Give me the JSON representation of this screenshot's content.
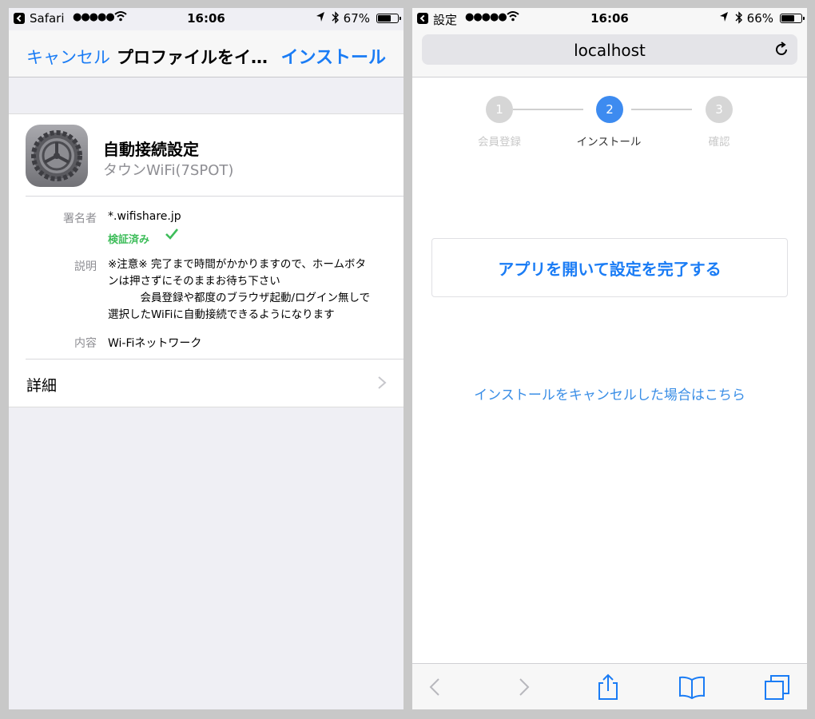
{
  "left": {
    "status": {
      "app": "Safari",
      "signal": "●●●●●",
      "time": "16:06",
      "battery_pct": "67%",
      "battery_level": 0.67
    },
    "nav": {
      "cancel": "キャンセル",
      "title": "プロファイルをイ…",
      "install": "インストール"
    },
    "profile": {
      "icon": "settings-gear-icon",
      "name": "自動接続設定",
      "org": "タウンWiFi(7SPOT)",
      "signer_label": "署名者",
      "signer": "*.wifishare.jp",
      "verified": "検証済み",
      "description_label": "説明",
      "description_lines": [
        "※注意※ 完了まで時間がかかりますので、ホームボタ",
        "ンは押さずにそのままお待ち下さい",
        "　　　会員登録や都度のブラウザ起動/ログイン無しで",
        "選択したWiFiに自動接続できるようになります"
      ],
      "contents_label": "内容",
      "contents": "Wi-Fiネットワーク",
      "details": "詳細"
    }
  },
  "right": {
    "status": {
      "app": "設定",
      "signal": "●●●●●",
      "time": "16:06",
      "battery_pct": "66%",
      "battery_level": 0.66
    },
    "url": "localhost",
    "steps": [
      {
        "number": "1",
        "label": "会員登録",
        "state": "done"
      },
      {
        "number": "2",
        "label": "インストール",
        "state": "active"
      },
      {
        "number": "3",
        "label": "確認",
        "state": "pending"
      }
    ],
    "open_app_button": "アプリを開いて設定を完了する",
    "cancel_link": "インストールをキャンセルした場合はこちら",
    "toolbar": [
      "back-icon",
      "forward-icon",
      "share-icon",
      "bookmarks-icon",
      "tabs-icon"
    ]
  },
  "colors": {
    "accent": "#1a7cf5",
    "link": "#3a8ee6",
    "verified": "#3ebd5a",
    "step_active": "#3d8bf0",
    "step_inactive": "#d6d6d6"
  }
}
